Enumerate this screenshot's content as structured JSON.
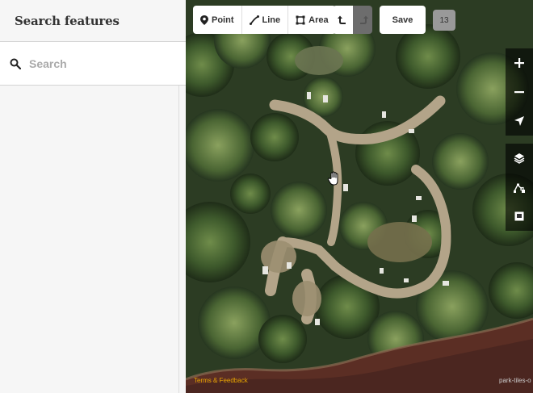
{
  "sidebar": {
    "title": "Search features",
    "search": {
      "placeholder": "Search",
      "value": ""
    }
  },
  "toolbar": {
    "point_label": "Point",
    "line_label": "Line",
    "area_label": "Area",
    "save_label": "Save",
    "edit_count": "13"
  },
  "map": {
    "attribution": "Terms & Feedback",
    "imagery_credit": "park-tiles-o"
  }
}
